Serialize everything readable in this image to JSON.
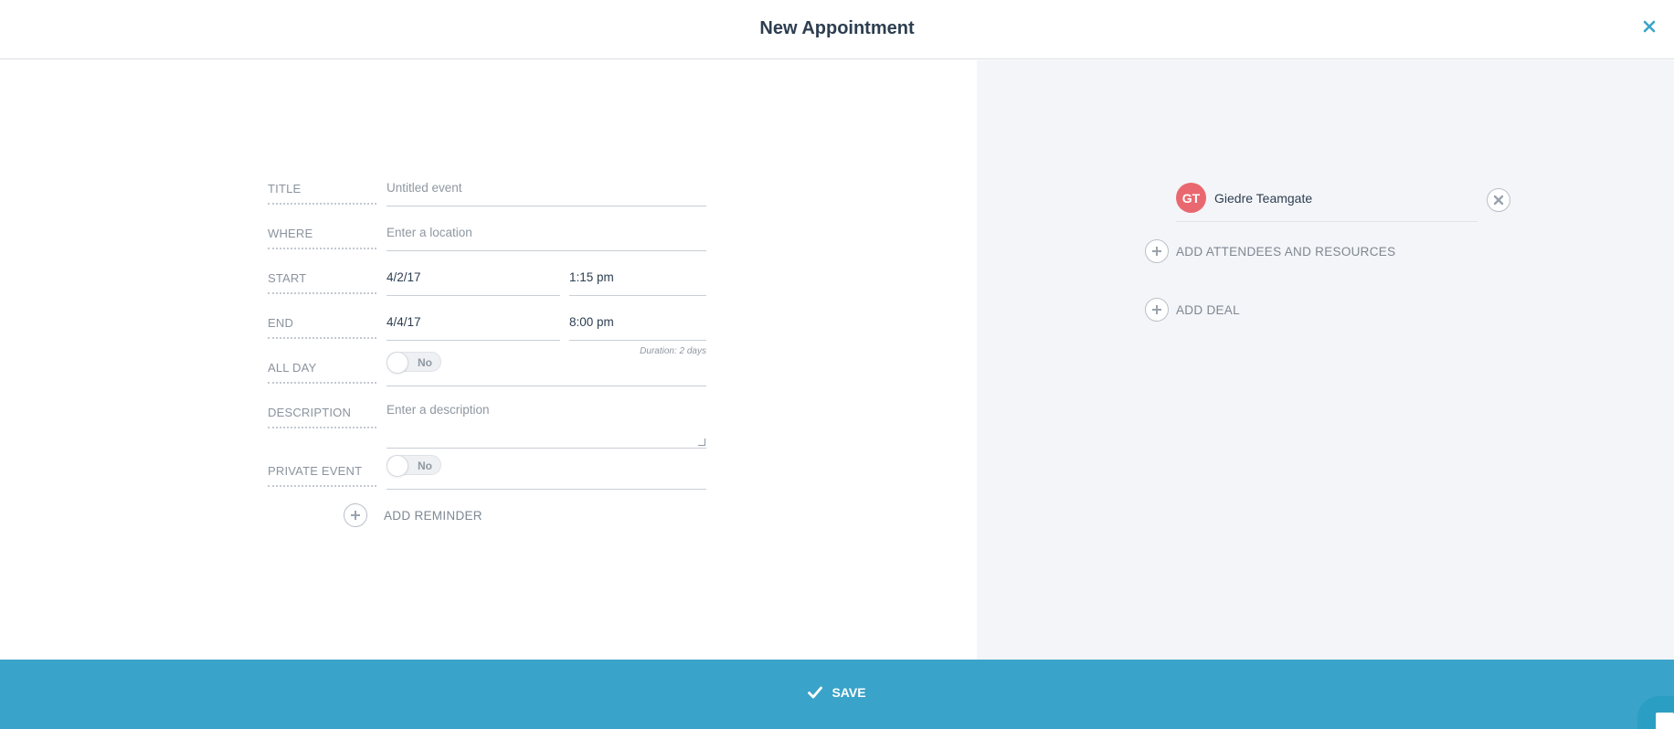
{
  "header": {
    "title": "New Appointment"
  },
  "form": {
    "title": {
      "label": "TITLE",
      "placeholder": "Untitled event",
      "value": ""
    },
    "where": {
      "label": "WHERE",
      "placeholder": "Enter a location",
      "value": ""
    },
    "start": {
      "label": "START",
      "date": "4/2/17",
      "time": "1:15 pm"
    },
    "end": {
      "label": "END",
      "date": "4/4/17",
      "time": "8:00 pm",
      "duration": "Duration: 2 days"
    },
    "all_day": {
      "label": "ALL DAY",
      "state": "No"
    },
    "description": {
      "label": "DESCRIPTION",
      "placeholder": "Enter a description"
    },
    "private_event": {
      "label": "PRIVATE EVENT",
      "state": "No"
    },
    "add_reminder": "ADD REMINDER"
  },
  "attendees": {
    "items": [
      {
        "initials": "GT",
        "name": "Giedre Teamgate",
        "color": "#e9686f"
      }
    ],
    "add_label": "ADD ATTENDEES AND RESOURCES",
    "add_deal": "ADD DEAL"
  },
  "footer": {
    "save_label": "SAVE",
    "color": "#3aa3c9"
  }
}
